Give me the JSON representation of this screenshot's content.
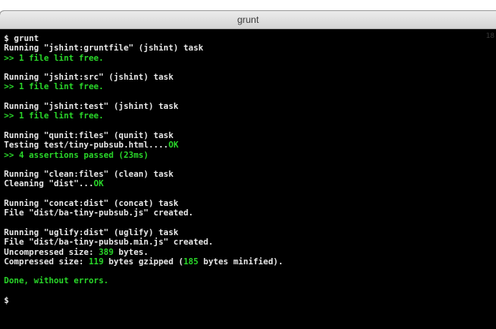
{
  "window": {
    "title": "grunt",
    "scroll_marker": "18"
  },
  "terminal": {
    "lines": [
      {
        "segments": [
          {
            "text": "$ grunt",
            "color": "white"
          }
        ]
      },
      {
        "segments": [
          {
            "text": "Running \"jshint:gruntfile\" (jshint) task",
            "color": "white"
          }
        ]
      },
      {
        "segments": [
          {
            "text": ">> 1 file lint free.",
            "color": "green"
          }
        ]
      },
      {
        "segments": []
      },
      {
        "segments": [
          {
            "text": "Running \"jshint:src\" (jshint) task",
            "color": "white"
          }
        ]
      },
      {
        "segments": [
          {
            "text": ">> 1 file lint free.",
            "color": "green"
          }
        ]
      },
      {
        "segments": []
      },
      {
        "segments": [
          {
            "text": "Running \"jshint:test\" (jshint) task",
            "color": "white"
          }
        ]
      },
      {
        "segments": [
          {
            "text": ">> 1 file lint free.",
            "color": "green"
          }
        ]
      },
      {
        "segments": []
      },
      {
        "segments": [
          {
            "text": "Running \"qunit:files\" (qunit) task",
            "color": "white"
          }
        ]
      },
      {
        "segments": [
          {
            "text": "Testing test/tiny-pubsub.html....",
            "color": "white"
          },
          {
            "text": "OK",
            "color": "green"
          }
        ]
      },
      {
        "segments": [
          {
            "text": ">> 4 assertions passed (23ms)",
            "color": "green"
          }
        ]
      },
      {
        "segments": []
      },
      {
        "segments": [
          {
            "text": "Running \"clean:files\" (clean) task",
            "color": "white"
          }
        ]
      },
      {
        "segments": [
          {
            "text": "Cleaning \"dist\"...",
            "color": "white"
          },
          {
            "text": "OK",
            "color": "green"
          }
        ]
      },
      {
        "segments": []
      },
      {
        "segments": [
          {
            "text": "Running \"concat:dist\" (concat) task",
            "color": "white"
          }
        ]
      },
      {
        "segments": [
          {
            "text": "File \"dist/ba-tiny-pubsub.js\" created.",
            "color": "white"
          }
        ]
      },
      {
        "segments": []
      },
      {
        "segments": [
          {
            "text": "Running \"uglify:dist\" (uglify) task",
            "color": "white"
          }
        ]
      },
      {
        "segments": [
          {
            "text": "File \"dist/ba-tiny-pubsub.min.js\" created.",
            "color": "white"
          }
        ]
      },
      {
        "segments": [
          {
            "text": "Uncompressed size: ",
            "color": "white"
          },
          {
            "text": "389",
            "color": "green"
          },
          {
            "text": " bytes.",
            "color": "white"
          }
        ]
      },
      {
        "segments": [
          {
            "text": "Compressed size: ",
            "color": "white"
          },
          {
            "text": "119",
            "color": "green"
          },
          {
            "text": " bytes gzipped (",
            "color": "white"
          },
          {
            "text": "185",
            "color": "green"
          },
          {
            "text": " bytes minified).",
            "color": "white"
          }
        ]
      },
      {
        "segments": []
      },
      {
        "segments": [
          {
            "text": "Done, without errors.",
            "color": "green"
          }
        ]
      },
      {
        "segments": []
      },
      {
        "segments": [
          {
            "text": "$",
            "color": "white"
          }
        ]
      }
    ]
  }
}
